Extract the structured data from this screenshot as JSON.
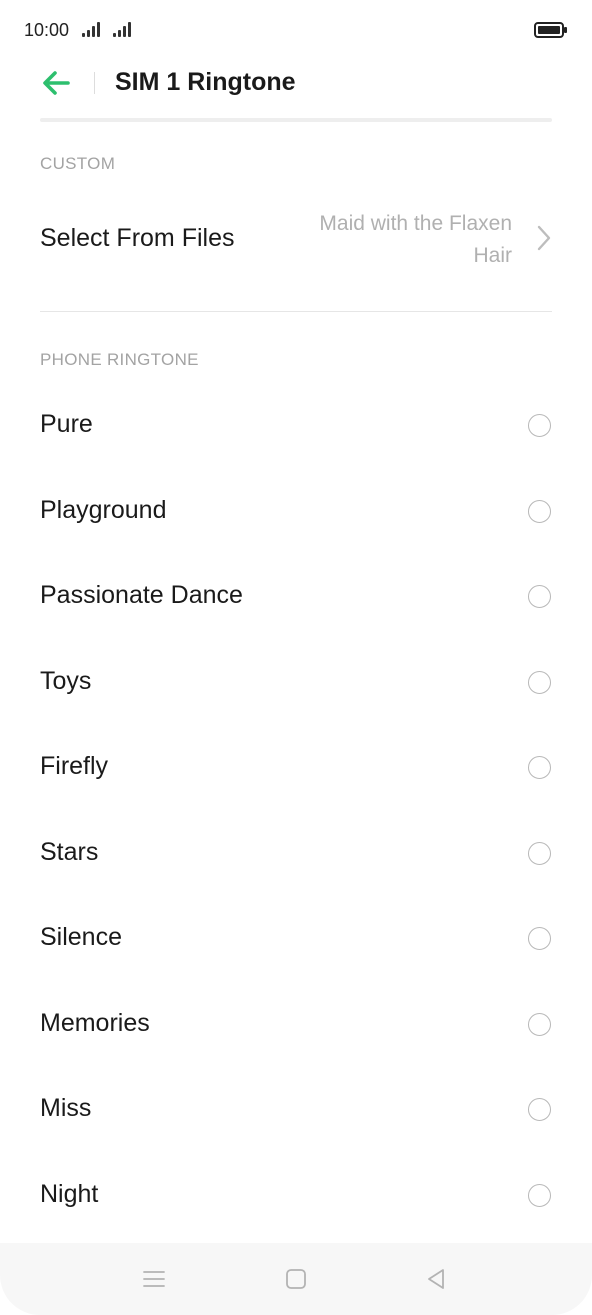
{
  "status_bar": {
    "time": "10:00"
  },
  "app_bar": {
    "title": "SIM 1 Ringtone"
  },
  "custom_section": {
    "header": "CUSTOM",
    "select_from_files": {
      "label": "Select From Files",
      "value": "Maid with the Flaxen Hair"
    }
  },
  "phone_ringtone_section": {
    "header": "PHONE RINGTONE",
    "items": [
      {
        "label": "Pure",
        "selected": false
      },
      {
        "label": "Playground",
        "selected": false
      },
      {
        "label": "Passionate Dance",
        "selected": false
      },
      {
        "label": "Toys",
        "selected": false
      },
      {
        "label": "Firefly",
        "selected": false
      },
      {
        "label": "Stars",
        "selected": false
      },
      {
        "label": "Silence",
        "selected": false
      },
      {
        "label": "Memories",
        "selected": false
      },
      {
        "label": "Miss",
        "selected": false
      },
      {
        "label": "Night",
        "selected": false
      }
    ]
  },
  "colors": {
    "accent": "#2dbf6e",
    "secondary_text": "#a3a3a3"
  },
  "icons": {
    "back": "arrow-left-icon",
    "chevron": "chevron-right-icon",
    "nav_menu": "menu-icon",
    "nav_home": "home-square-icon",
    "nav_back": "back-triangle-icon"
  }
}
